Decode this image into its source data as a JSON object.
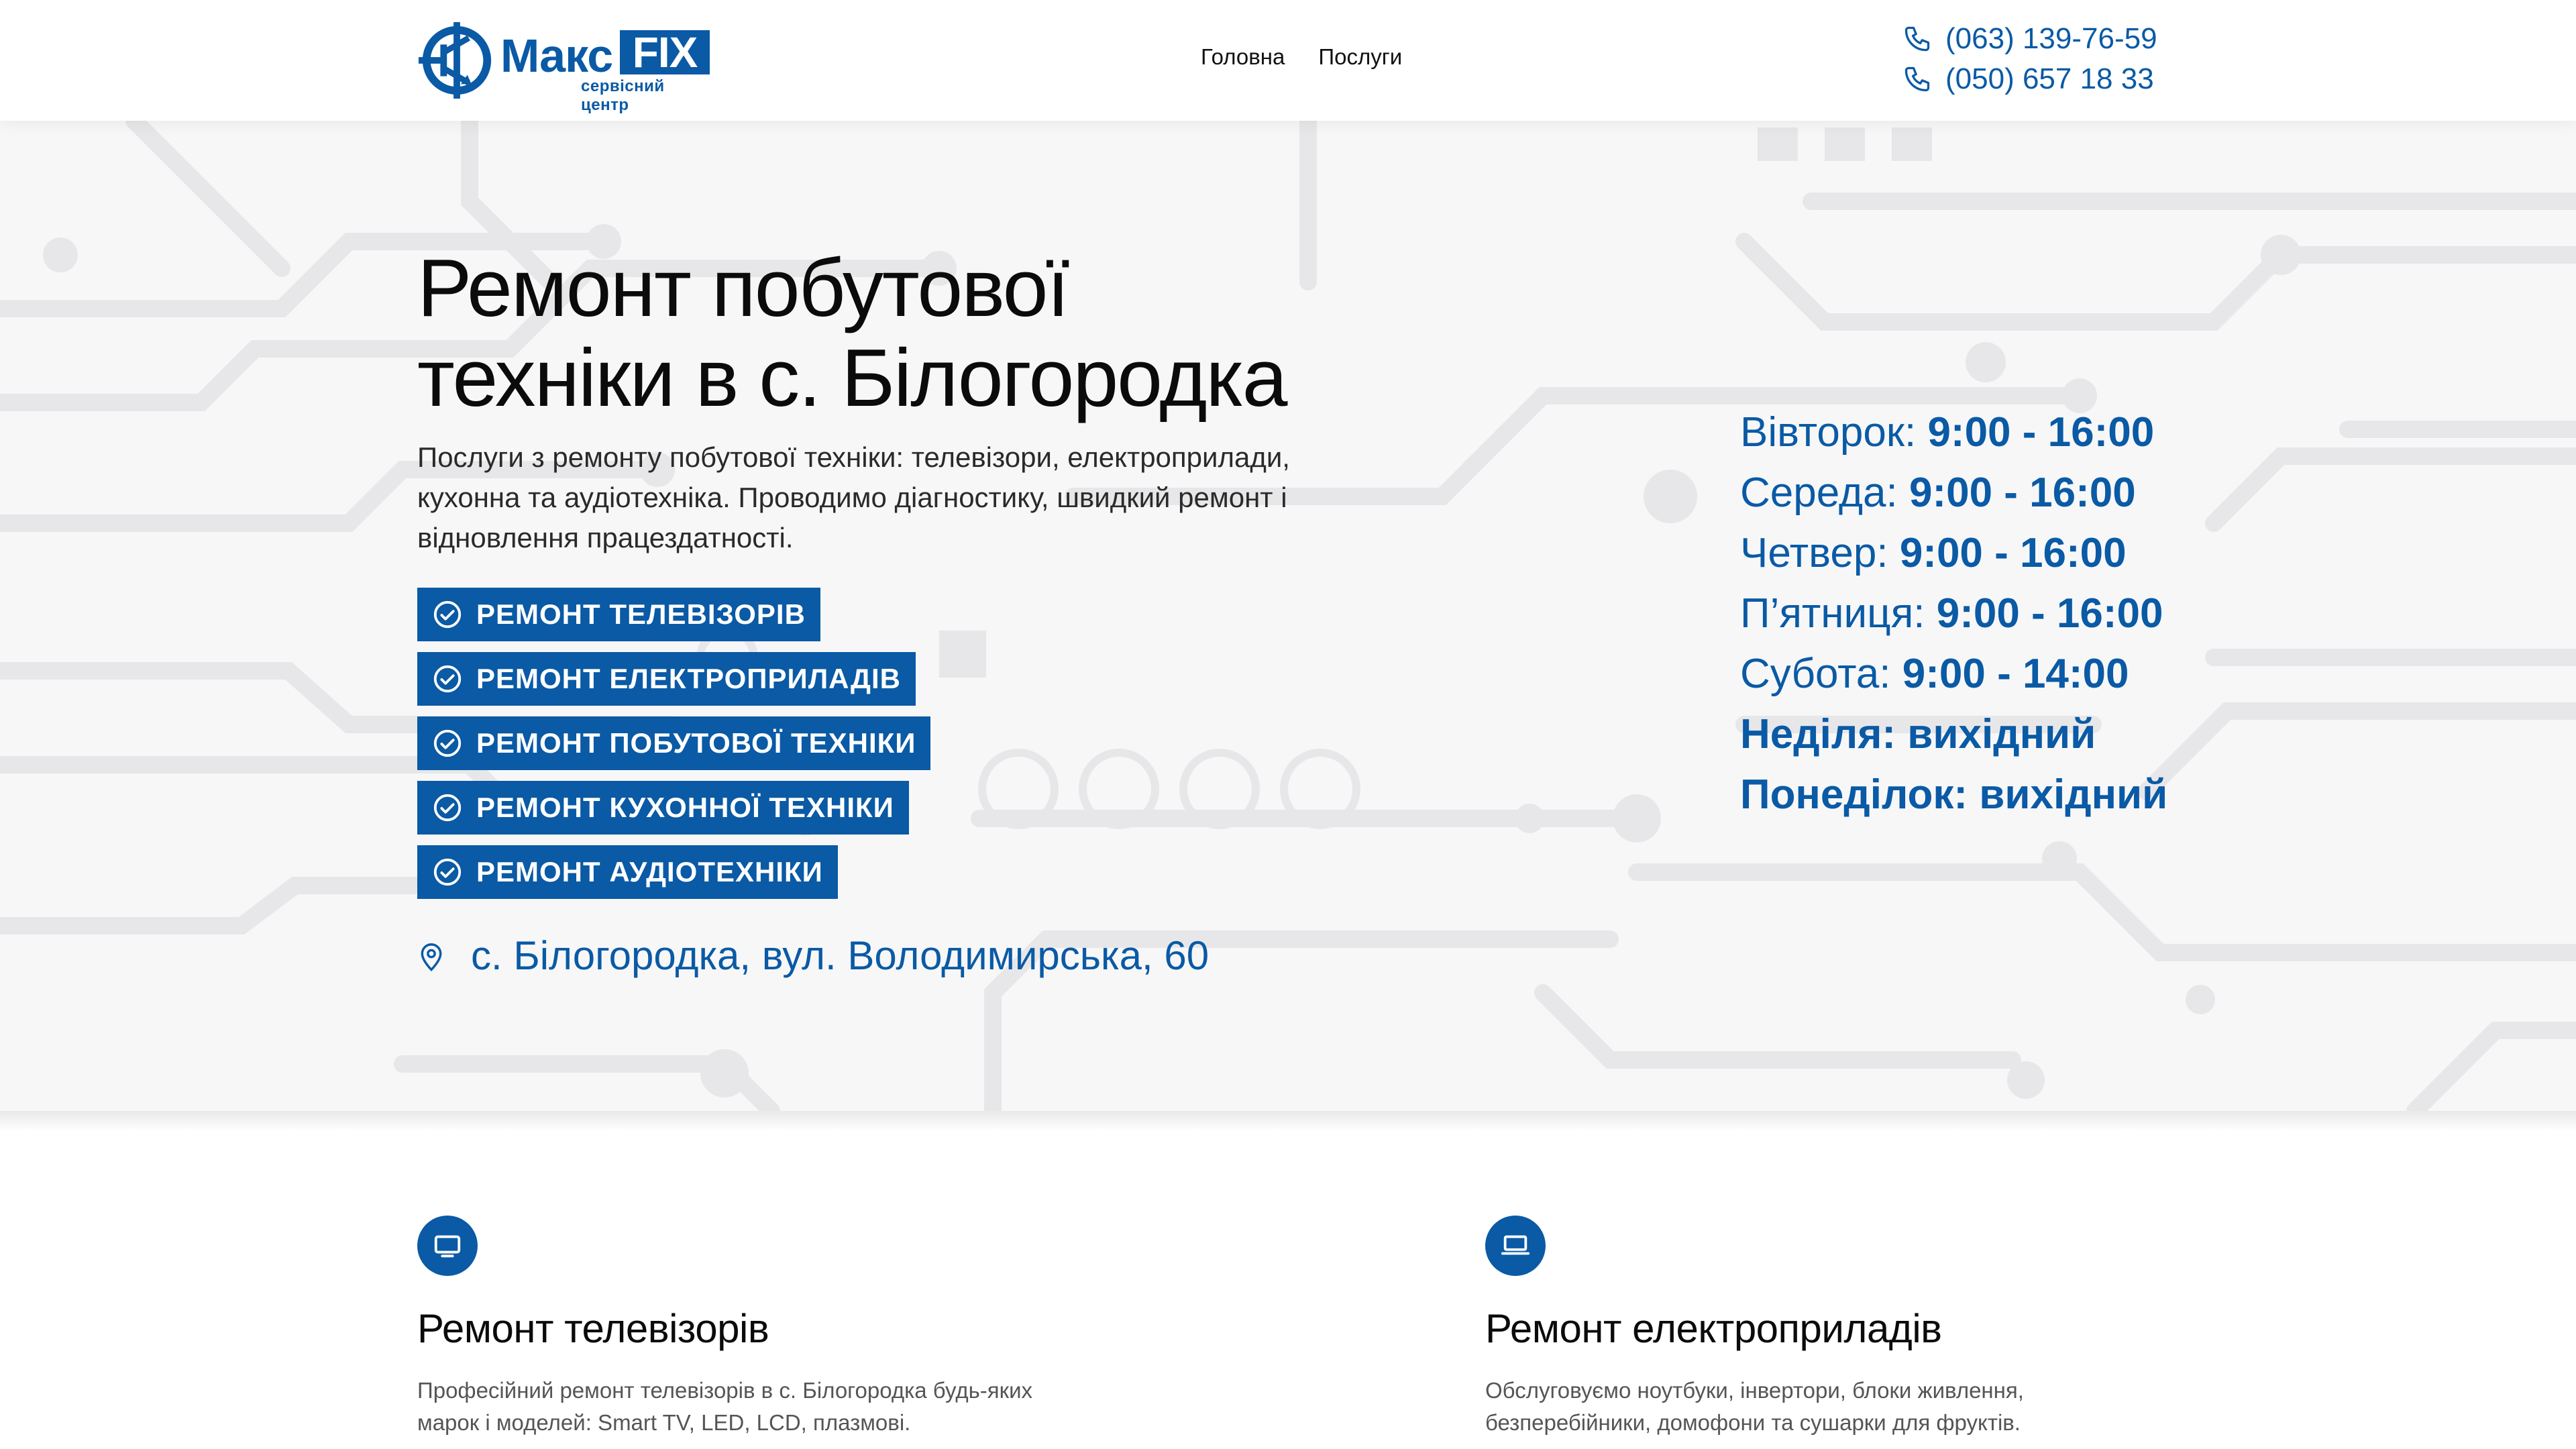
{
  "header": {
    "logo": {
      "brand_left": "Макс",
      "brand_right": "FIX",
      "tagline": "сервісний центр"
    },
    "nav": [
      "Головна",
      "Послуги"
    ],
    "phones": [
      "(063) 139-76-59",
      "(050) 657 18 33"
    ]
  },
  "hero": {
    "title_line1": "Ремонт побутової",
    "title_line2": "техніки в с. Білогородка",
    "description": "Послуги з ремонту побутової техніки: телевізори, електроприлади, кухонна та аудіотехніка. Проводимо діагностику, швидкий ремонт і відновлення працездатності.",
    "services": [
      "РЕМОНТ ТЕЛЕВІЗОРІВ",
      "РЕМОНТ ЕЛЕКТРОПРИЛАДІВ",
      "РЕМОНТ ПОБУТОВОЇ ТЕХНІКИ",
      "РЕМОНТ КУХОННОЇ ТЕХНІКИ",
      "РЕМОНТ АУДІОТЕХНІКИ"
    ],
    "address": "с. Білогородка, вул. Володимирська, 60"
  },
  "hours": [
    {
      "day": "Вівторок:",
      "time": "9:00 - 16:00"
    },
    {
      "day": "Середа:",
      "time": "9:00 - 16:00"
    },
    {
      "day": "Четвер:",
      "time": "9:00 - 16:00"
    },
    {
      "day": "П’ятниця:",
      "time": "9:00 - 16:00"
    },
    {
      "day": "Субота:",
      "time": "9:00 - 14:00"
    },
    {
      "day": "Неділя:",
      "time": "вихідний"
    },
    {
      "day": "Понеділок:",
      "time": "вихідний"
    }
  ],
  "cards": [
    {
      "icon": "tv-icon",
      "title": "Ремонт телевізорів",
      "text": "Професійний ремонт телевізорів в с. Білогородка будь-яких марок і моделей: Smart TV, LED, LCD, плазмові."
    },
    {
      "icon": "laptop-icon",
      "title": "Ремонт електроприладів",
      "text": "Обслуговуємо ноутбуки, інвертори, блоки живлення, безперебійники, домофони та сушарки для фруктів."
    }
  ],
  "colors": {
    "brand": "#0a5aa5",
    "hero_bg": "#f7f7f8",
    "circuit": "#e6e6e8"
  }
}
